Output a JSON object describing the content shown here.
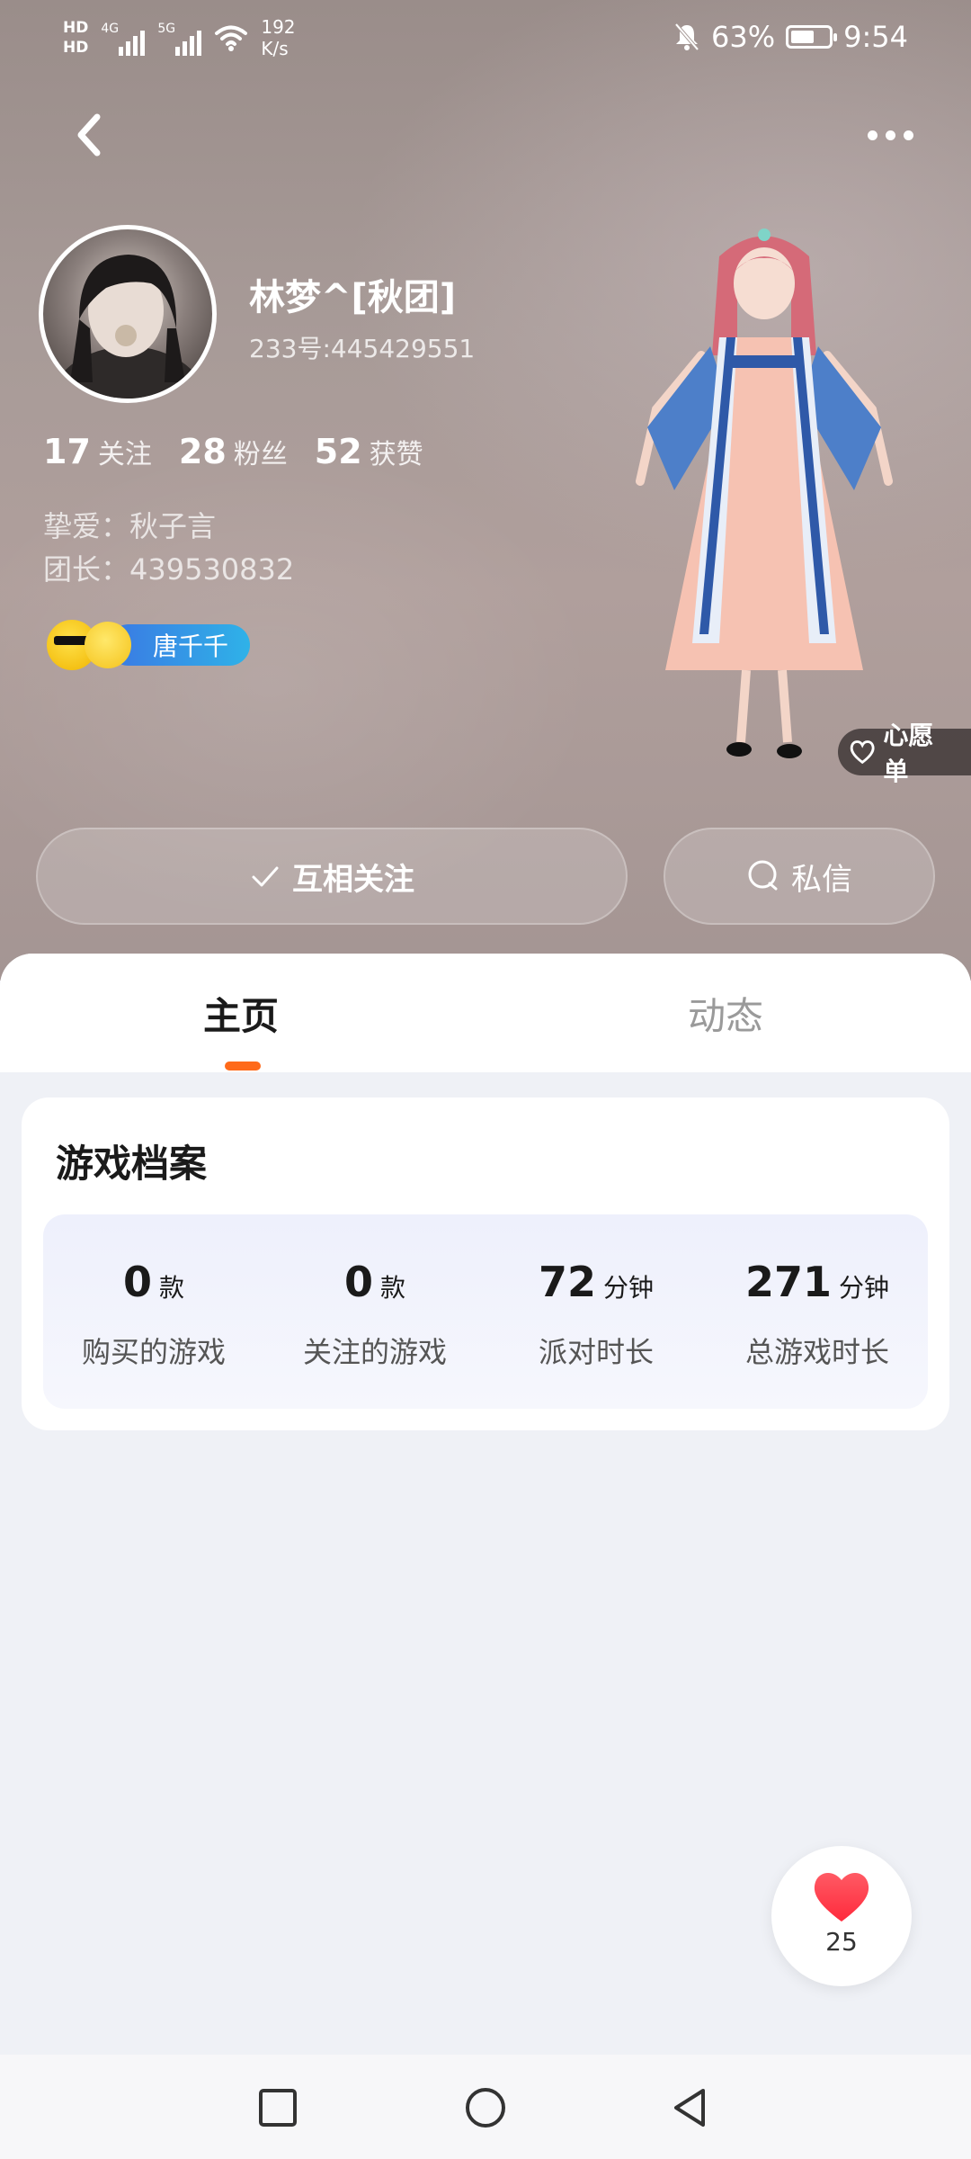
{
  "status_bar": {
    "hd1": "HD",
    "hd2": "HD",
    "net1": "4G",
    "net2": "5G",
    "speed_value": "192",
    "speed_unit": "K/s",
    "battery": "63%",
    "battery_level": 0.63,
    "time": "9:54"
  },
  "profile": {
    "nickname": "林梦^[秋团]",
    "id_line": "233号:445429551",
    "stats": [
      {
        "num": "17",
        "label": "关注"
      },
      {
        "num": "28",
        "label": "粉丝"
      },
      {
        "num": "52",
        "label": "获赞"
      }
    ],
    "bio": [
      "挚爱：秋子言",
      "团长：439530832"
    ],
    "badge_name": "唐千千",
    "wishlist": "心愿单"
  },
  "actions": {
    "follow": "互相关注",
    "message": "私信"
  },
  "tabs": [
    {
      "label": "主页",
      "active": true
    },
    {
      "label": "动态",
      "active": false
    }
  ],
  "game_profile": {
    "title": "游戏档案",
    "items": [
      {
        "num": "0",
        "unit": "款",
        "label": "购买的游戏"
      },
      {
        "num": "0",
        "unit": "款",
        "label": "关注的游戏"
      },
      {
        "num": "72",
        "unit": "分钟",
        "label": "派对时长"
      },
      {
        "num": "271",
        "unit": "分钟",
        "label": "总游戏时长"
      }
    ]
  },
  "likes": {
    "count": "25"
  },
  "colors": {
    "accent": "#ff6a1a",
    "badge_start": "#3b78e3",
    "badge_end": "#2fb2e8",
    "heart": "#ff3b4a"
  }
}
